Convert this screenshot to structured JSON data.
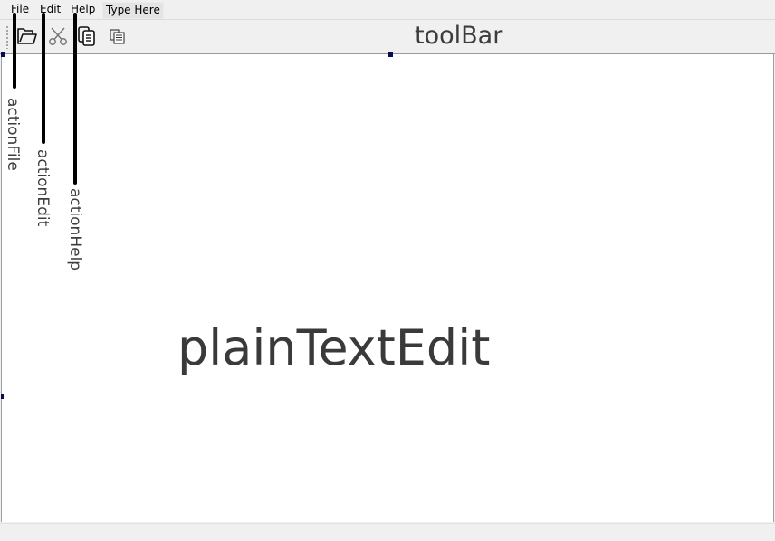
{
  "menubar": {
    "items": [
      {
        "label": "File"
      },
      {
        "label": "Edit"
      },
      {
        "label": "Help"
      }
    ],
    "type_here": "Type Here"
  },
  "toolbar": {
    "label": "toolBar",
    "buttons": [
      {
        "icon": "folder-open-icon"
      },
      {
        "icon": "scissors-icon"
      },
      {
        "icon": "copy-icon"
      },
      {
        "icon": "paste-icon"
      }
    ]
  },
  "editor": {
    "label": "plainTextEdit"
  },
  "annotations": [
    {
      "label": "actionFile"
    },
    {
      "label": "actionEdit"
    },
    {
      "label": "actionHelp"
    }
  ],
  "colors": {
    "handle": "#0a0a5a",
    "annotation_line": "#000000"
  }
}
